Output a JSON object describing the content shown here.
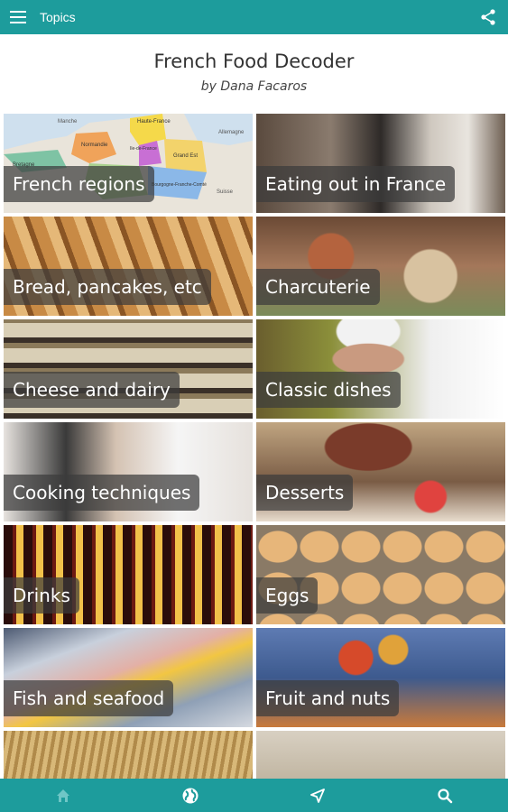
{
  "topbar": {
    "title": "Topics"
  },
  "header": {
    "title": "French Food Decoder",
    "author": "by Dana Facaros"
  },
  "topics": [
    {
      "label": "French regions"
    },
    {
      "label": "Eating out in France"
    },
    {
      "label": "Bread, pancakes, etc"
    },
    {
      "label": "Charcuterie"
    },
    {
      "label": "Cheese and dairy"
    },
    {
      "label": "Classic dishes"
    },
    {
      "label": "Cooking techniques"
    },
    {
      "label": "Desserts"
    },
    {
      "label": "Drinks"
    },
    {
      "label": "Eggs"
    },
    {
      "label": "Fish and seafood"
    },
    {
      "label": "Fruit and nuts"
    },
    {
      "label": ""
    },
    {
      "label": ""
    }
  ],
  "map_labels": [
    "Haute-France",
    "Normandie",
    "Ile-de-France",
    "Grand Est",
    "Bourgogne-Franche-Comté",
    "Bretagne",
    "Allemagne",
    "Suisse",
    "Manche"
  ],
  "bottom_nav": [
    "home-icon",
    "globe-icon",
    "navigation-icon",
    "search-icon"
  ],
  "colors": {
    "primary": "#1d9c9c",
    "label_bg": "#3c3c3c"
  }
}
